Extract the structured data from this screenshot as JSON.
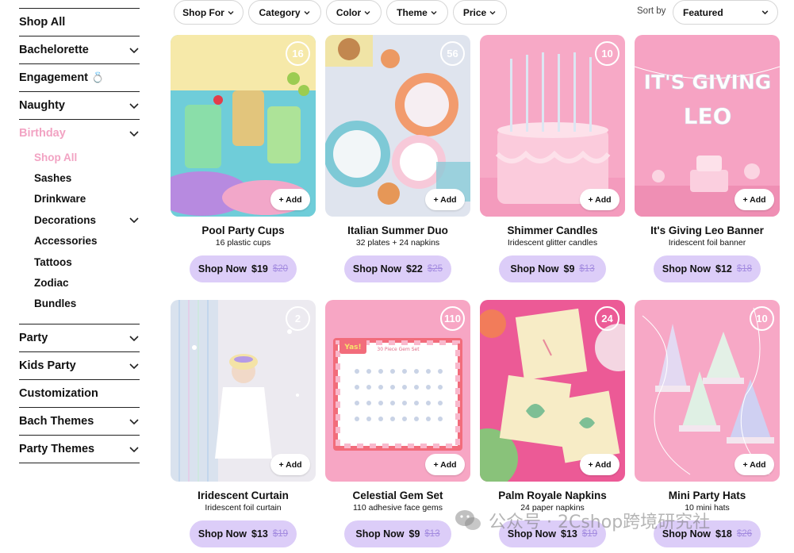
{
  "sidebar": {
    "items": [
      {
        "label": "Shop All",
        "chevron": false
      },
      {
        "label": "Bachelorette",
        "chevron": true
      },
      {
        "label": "Engagement",
        "chevron": false,
        "emoji": "💍"
      },
      {
        "label": "Naughty",
        "chevron": true
      },
      {
        "label": "Birthday",
        "chevron": true,
        "active": true
      }
    ],
    "birthday_sub": [
      {
        "label": "Shop All",
        "active": true
      },
      {
        "label": "Sashes"
      },
      {
        "label": "Drinkware"
      },
      {
        "label": "Decorations",
        "chevron": true
      },
      {
        "label": "Accessories"
      },
      {
        "label": "Tattoos"
      },
      {
        "label": "Zodiac"
      },
      {
        "label": "Bundles"
      }
    ],
    "items_after": [
      {
        "label": "Party",
        "chevron": true
      },
      {
        "label": "Kids Party",
        "chevron": true
      },
      {
        "label": "Customization",
        "chevron": false
      },
      {
        "label": "Bach Themes",
        "chevron": true
      },
      {
        "label": "Party Themes",
        "chevron": true
      }
    ]
  },
  "filters": [
    "Shop For",
    "Category",
    "Color",
    "Theme",
    "Price"
  ],
  "sort": {
    "label": "Sort by",
    "value": "Featured"
  },
  "add_label": "+ Add",
  "shop_label": "Shop Now",
  "colors": {
    "accent_pink": "#f2a3c3",
    "button_lavender": "#dccdf8",
    "old_price": "#a48ce0"
  },
  "products": [
    {
      "title": "Pool Party Cups",
      "subtitle": "16 plastic cups",
      "count": "16",
      "price": "$19",
      "old_price": "$20"
    },
    {
      "title": "Italian Summer Duo",
      "subtitle": "32 plates + 24 napkins",
      "count": "56",
      "price": "$22",
      "old_price": "$25"
    },
    {
      "title": "Shimmer Candles",
      "subtitle": "Iridescent glitter candles",
      "count": "10",
      "price": "$9",
      "old_price": "$13"
    },
    {
      "title": "It's Giving Leo Banner",
      "subtitle": "Iridescent foil banner",
      "count": "",
      "price": "$12",
      "old_price": "$18",
      "banner_text_1": "IT'S GIVING",
      "banner_text_2": "LEO"
    },
    {
      "title": "Iridescent Curtain",
      "subtitle": "Iridescent foil curtain",
      "count": "2",
      "price": "$13",
      "old_price": "$19"
    },
    {
      "title": "Celestial Gem Set",
      "subtitle": "110 adhesive face gems",
      "count": "110",
      "price": "$9",
      "old_price": "$13",
      "package_brand": "Yas!",
      "package_label": "30 Piece Gem Set"
    },
    {
      "title": "Palm Royale Napkins",
      "subtitle": "24 paper napkins",
      "count": "24",
      "price": "$13",
      "old_price": "$19"
    },
    {
      "title": "Mini Party Hats",
      "subtitle": "10 mini hats",
      "count": "10",
      "price": "$18",
      "old_price": "$26"
    }
  ],
  "watermark": {
    "text": "公众号 · 2Cshop跨境研究社",
    "icon": "wechat-icon"
  }
}
